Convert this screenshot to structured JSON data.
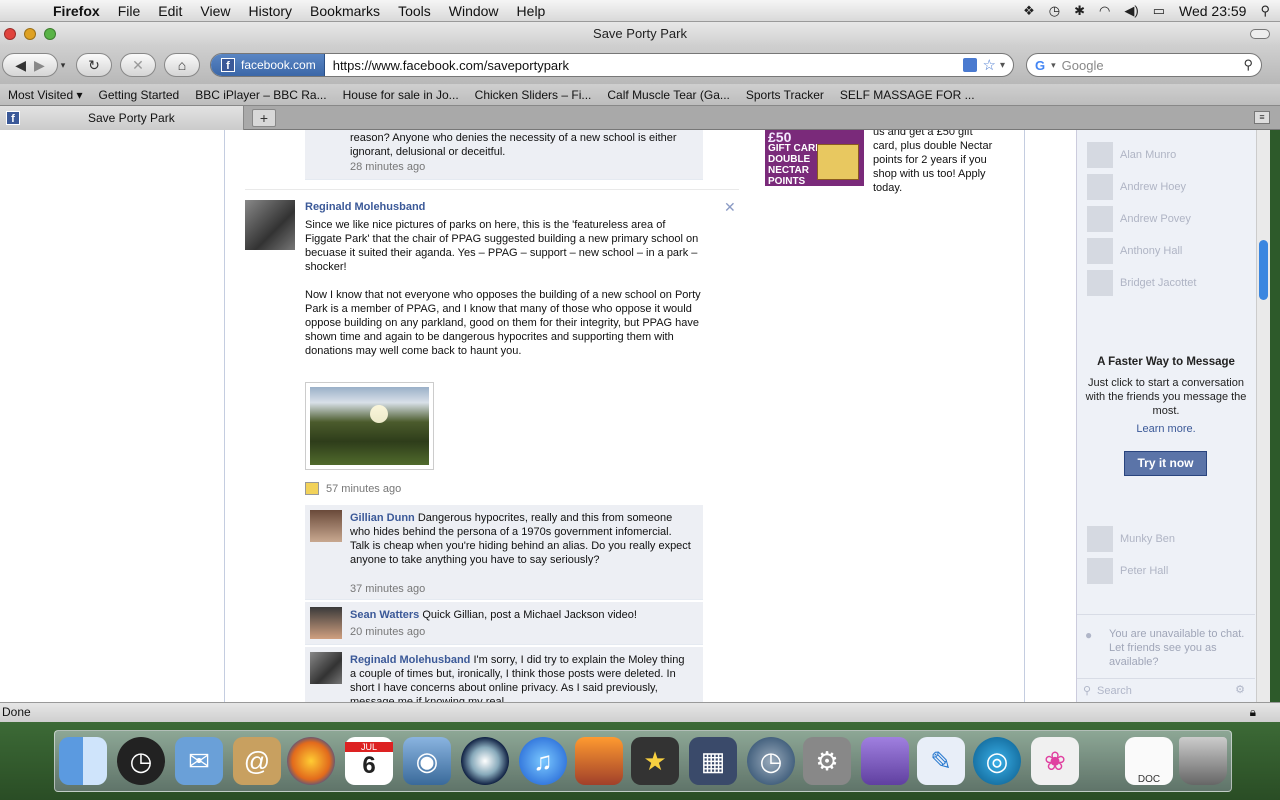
{
  "menubar": {
    "app": "Firefox",
    "items": [
      "File",
      "Edit",
      "View",
      "History",
      "Bookmarks",
      "Tools",
      "Window",
      "Help"
    ],
    "clock": "Wed 23:59"
  },
  "window": {
    "title": "Save Porty Park"
  },
  "toolbar": {
    "site_identity": "facebook.com",
    "url": "https://www.facebook.com/saveportypark",
    "search_placeholder": "Google"
  },
  "bookmarks": [
    "Most Visited",
    "Getting Started",
    "BBC iPlayer – BBC Ra...",
    "House for sale in Jo...",
    "Chicken Sliders – Fi...",
    "Calf Muscle Tear (Ga...",
    "Sports Tracker",
    "SELF MASSAGE FOR ..."
  ],
  "tabs": [
    {
      "title": "Save Porty Park"
    }
  ],
  "feed": {
    "prev_comment_text": "reason? Anyone who denies the necessity of a new school is either ignorant, delusional or deceitful.",
    "prev_comment_time": "28 minutes ago",
    "post": {
      "author": "Reginald Molehusband",
      "paragraph1": "Since we like nice pictures of parks on here, this is the 'featureless area of Figgate Park' that the chair of PPAG suggested building a new primary school on becuase it suited their aganda. Yes – PPAG – support – new school – in a park – shocker!",
      "paragraph2": "Now I know that not everyone who opposes the building of a new school on Porty Park is a member of PPAG, and I know that many of those who oppose it would oppose building on any parkland, good on them for their integrity, but PPAG have shown time and again to be dangerous hypocrites and supporting them with donations may well come back to haunt you.",
      "time": "57 minutes ago"
    },
    "comments": [
      {
        "author": "Gillian Dunn",
        "text": "Dangerous hypocrites, really and this from someone who hides behind the persona of a 1970s government infomercial. Talk is cheap when you're hiding behind an alias. Do you really expect anyone to take anything you have to say seriously?",
        "time": "37 minutes ago"
      },
      {
        "author": "Sean Watters",
        "text": "Quick Gillian, post a Michael Jackson video!",
        "time": "20 minutes ago"
      },
      {
        "author": "Reginald Molehusband",
        "text": "I'm sorry, I did try to explain the Moley thing a couple of times but, ironically, I think those posts were deleted. In short I have concerns about online privacy. As I said previously, message me if knowing my real",
        "time": ""
      }
    ]
  },
  "ad": {
    "badge_top": "£50",
    "badge_line1": "GIFT CARD",
    "badge_line2": "DOUBLE",
    "badge_line3": "NECTAR",
    "badge_line4": "POINTS",
    "text": "us and get a £50 gift card, plus double Nectar points for 2 years if you shop with us too! Apply today."
  },
  "chat": {
    "friends_top": [
      "Alan Munro",
      "Andrew Hoey",
      "Andrew Povey",
      "Anthony Hall",
      "Bridget Jacottet"
    ],
    "promo_title": "A Faster Way to Message",
    "promo_text": "Just click to start a conversation with the friends you message the most.",
    "learn_more": "Learn more.",
    "try_button": "Try it now",
    "friends_bottom": [
      "Munky Ben",
      "Peter Hall"
    ],
    "unavailable_text": "You are unavailable to chat. Let friends see you as available?",
    "search_placeholder": "Search"
  },
  "status": {
    "text": "Done"
  },
  "dock": {
    "icons": [
      "finder-icon",
      "dashboard-icon",
      "mail-icon",
      "address-book-icon",
      "firefox-icon",
      "ical-icon",
      "iphoto-icon",
      "dvd-player-icon",
      "itunes-icon",
      "photo-booth-icon",
      "imovie-icon",
      "spaces-icon",
      "time-machine-icon",
      "system-preferences-icon",
      "stacks-icon",
      "quill-icon",
      "airport-icon",
      "butterfly-icon",
      "doc-icon",
      "trash-icon"
    ],
    "calendar_month": "JUL",
    "calendar_day": "6",
    "doc_label": "DOC"
  },
  "colors": {
    "facebook_blue": "#3b5998",
    "chat_bg": "#eef1f7",
    "comment_bg": "#edeff4"
  }
}
